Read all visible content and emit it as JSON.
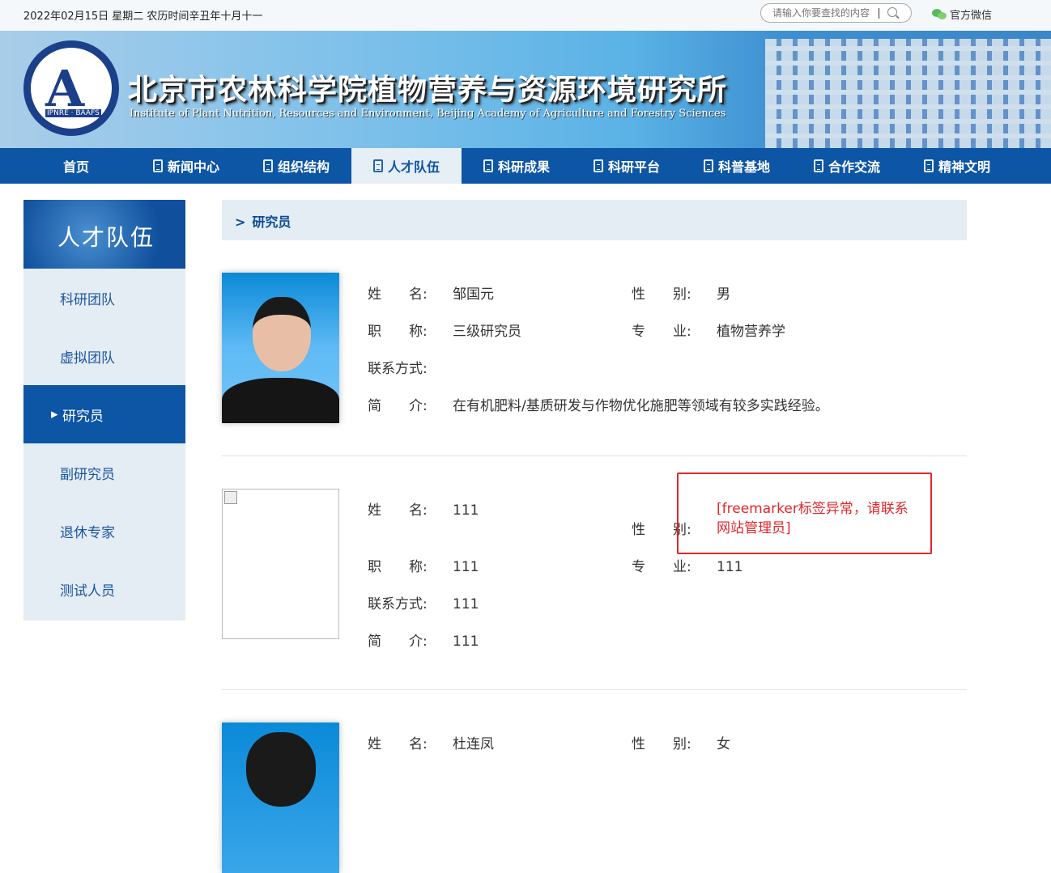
{
  "topbar": {
    "date": "2022年02月15日 星期二 农历时间辛丑年十月十一",
    "search_placeholder": "请输入你要查找的内容",
    "wechat": "官方微信"
  },
  "banner": {
    "title_cn": "北京市农林科学院植物营养与资源环境研究所",
    "title_en": "Institute of Plant Nutrition, Resources and Environment, Beijing Academy of Agriculture and Forestry Sciences",
    "logo_text": "IPNRE · BAAFS"
  },
  "nav": [
    "首页",
    "新闻中心",
    "组织结构",
    "人才队伍",
    "科研成果",
    "科研平台",
    "科普基地",
    "合作交流",
    "精神文明"
  ],
  "sidebar": {
    "title": "人才队伍",
    "items": [
      "科研团队",
      "虚拟团队",
      "研究员",
      "副研究员",
      "退休专家",
      "测试人员"
    ]
  },
  "breadcrumb": {
    "arrow": ">",
    "current": "研究员"
  },
  "labels": {
    "name": "姓　　名:",
    "gender": "性　　别:",
    "title": "职　　称:",
    "major": "专　　业:",
    "contact": "联系方式:",
    "intro": "简　　介:"
  },
  "people": [
    {
      "name": "邹国元",
      "gender": "男",
      "title": "三级研究员",
      "major": "植物营养学",
      "contact": "",
      "intro": "在有机肥料/基质研发与作物优化施肥等领域有较多实践经验。"
    },
    {
      "name": "111",
      "gender_error": "[freemarker标签异常，请联系网站管理员]",
      "title": "111",
      "major": "111",
      "contact": "111",
      "intro": "111"
    },
    {
      "name": "杜连凤",
      "gender": "女"
    }
  ]
}
